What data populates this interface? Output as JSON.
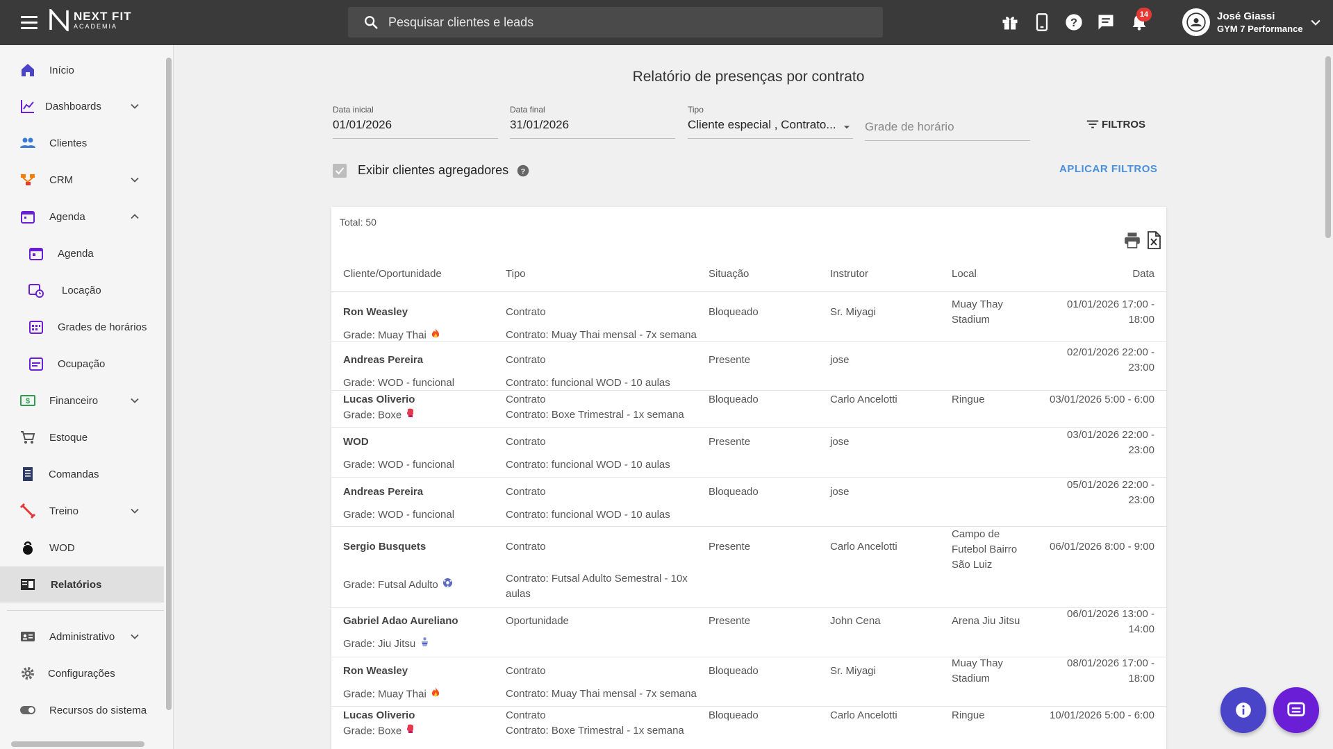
{
  "app": {
    "logo_main": "NEXT FIT",
    "logo_sub": "ACADEMIA"
  },
  "topbar": {
    "search_placeholder": "Pesquisar clientes e leads",
    "notification_count": "14",
    "user_name": "José Giassi",
    "user_org": "GYM 7 Performance",
    "icons": [
      "gift-icon",
      "mobile-icon",
      "help-icon",
      "chat-icon",
      "bell-icon"
    ]
  },
  "sidebar": {
    "items": [
      {
        "label": "Início",
        "icon": "home-icon"
      },
      {
        "label": "Dashboards",
        "icon": "chart-icon",
        "expand": "down"
      },
      {
        "label": "Clientes",
        "icon": "people-icon"
      },
      {
        "label": "CRM",
        "icon": "crm-icon",
        "expand": "down"
      },
      {
        "label": "Agenda",
        "icon": "calendar-icon",
        "expand": "up"
      },
      {
        "label": "Agenda",
        "icon": "calendar-day-icon"
      },
      {
        "label": "Locação",
        "icon": "calendar-clock-icon"
      },
      {
        "label": "Grades de horários",
        "icon": "calendar-grid-icon"
      },
      {
        "label": "Ocupação",
        "icon": "calendar-list-icon"
      },
      {
        "label": "Financeiro",
        "icon": "money-icon",
        "expand": "down"
      },
      {
        "label": "Estoque",
        "icon": "cart-icon"
      },
      {
        "label": "Comandas",
        "icon": "receipt-icon"
      },
      {
        "label": "Treino",
        "icon": "dumbbell-icon",
        "expand": "down"
      },
      {
        "label": "WOD",
        "icon": "kettlebell-icon"
      },
      {
        "label": "Relatórios",
        "icon": "report-icon",
        "active": true
      },
      {
        "label": "Administrativo",
        "icon": "id-card-icon",
        "expand": "down"
      },
      {
        "label": "Configurações",
        "icon": "gear-icon"
      },
      {
        "label": "Recursos do sistema",
        "icon": "toggle-icon"
      }
    ]
  },
  "page": {
    "title": "Relatório de presenças por contrato",
    "filters": {
      "start_label": "Data inicial",
      "start_value": "01/01/2026",
      "end_label": "Data final",
      "end_value": "31/01/2026",
      "type_label": "Tipo",
      "type_value": "Cliente especial , Contrato...",
      "schedule_placeholder": "Grade de horário",
      "filters_button": "FILTROS",
      "checkbox_label": "Exibir clientes agregadores",
      "apply_button": "APLICAR FILTROS"
    },
    "report": {
      "total": "Total: 50",
      "columns": [
        "Cliente/Oportunidade",
        "Tipo",
        "Situação",
        "Instrutor",
        "Local",
        "Data"
      ],
      "rows": [
        {
          "name": "Ron Weasley",
          "grade": "Grade: Muay Thai",
          "emoji": "fire",
          "type": "Contrato",
          "contract": "Contrato: Muay Thai mensal - 7x semana",
          "status": "Bloqueado",
          "instructor": "Sr. Miyagi",
          "local": "Muay Thay Stadium",
          "date": "01/01/2026 17:00 - 18:00"
        },
        {
          "name": "Andreas Pereira",
          "grade": "Grade: WOD - funcional",
          "emoji": "",
          "type": "Contrato",
          "contract": "Contrato: funcional WOD - 10 aulas",
          "status": "Presente",
          "instructor": "jose",
          "local": "",
          "date": "02/01/2026 22:00 - 23:00"
        },
        {
          "name": "Lucas Oliverio",
          "grade": "Grade: Boxe",
          "emoji": "boxing",
          "type": "Contrato",
          "contract": "Contrato: Boxe Trimestral - 1x semana",
          "status": "Bloqueado",
          "instructor": "Carlo Ancelotti",
          "local": "Ringue",
          "date": "03/01/2026 5:00 - 6:00"
        },
        {
          "name": "WOD",
          "grade": "Grade: WOD - funcional",
          "emoji": "",
          "type": "Contrato",
          "contract": "Contrato: funcional WOD - 10 aulas",
          "status": "Presente",
          "instructor": "jose",
          "local": "",
          "date": "03/01/2026 22:00 - 23:00"
        },
        {
          "name": "Andreas Pereira",
          "grade": "Grade: WOD - funcional",
          "emoji": "",
          "type": "Contrato",
          "contract": "Contrato: funcional WOD - 10 aulas",
          "status": "Bloqueado",
          "instructor": "jose",
          "local": "",
          "date": "05/01/2026 22:00 - 23:00"
        },
        {
          "name": "Sergio Busquets",
          "grade": "Grade: Futsal Adulto",
          "emoji": "ball",
          "type": "Contrato",
          "contract": "Contrato: Futsal Adulto Semestral - 10x aulas",
          "status": "Presente",
          "instructor": "Carlo Ancelotti",
          "local": "Campo de Futebol Bairro São Luiz",
          "date": "06/01/2026 8:00 - 9:00"
        },
        {
          "name": "Gabriel Adao Aureliano",
          "grade": "Grade: Jiu Jitsu",
          "emoji": "gi",
          "type": "Oportunidade",
          "contract": "",
          "status": "Presente",
          "instructor": "John Cena",
          "local": "Arena Jiu Jitsu",
          "date": "06/01/2026 13:00 - 14:00"
        },
        {
          "name": "Ron Weasley",
          "grade": "Grade: Muay Thai",
          "emoji": "fire",
          "type": "Contrato",
          "contract": "Contrato: Muay Thai mensal - 7x semana",
          "status": "Bloqueado",
          "instructor": "Sr. Miyagi",
          "local": "Muay Thay Stadium",
          "date": "08/01/2026 17:00 - 18:00"
        },
        {
          "name": "Lucas Oliverio",
          "grade": "Grade: Boxe",
          "emoji": "boxing",
          "type": "Contrato",
          "contract": "Contrato: Boxe Trimestral - 1x semana",
          "status": "Bloqueado",
          "instructor": "Carlo Ancelotti",
          "local": "Ringue",
          "date": "10/01/2026 5:00 - 6:00"
        }
      ]
    }
  },
  "colors": {
    "topbar": "#3a3a3a",
    "accent_blue": "#4a90d9",
    "badge_red": "#e53935",
    "fab_info": "#4a44c8",
    "fab_chat": "#6a1fd6"
  }
}
